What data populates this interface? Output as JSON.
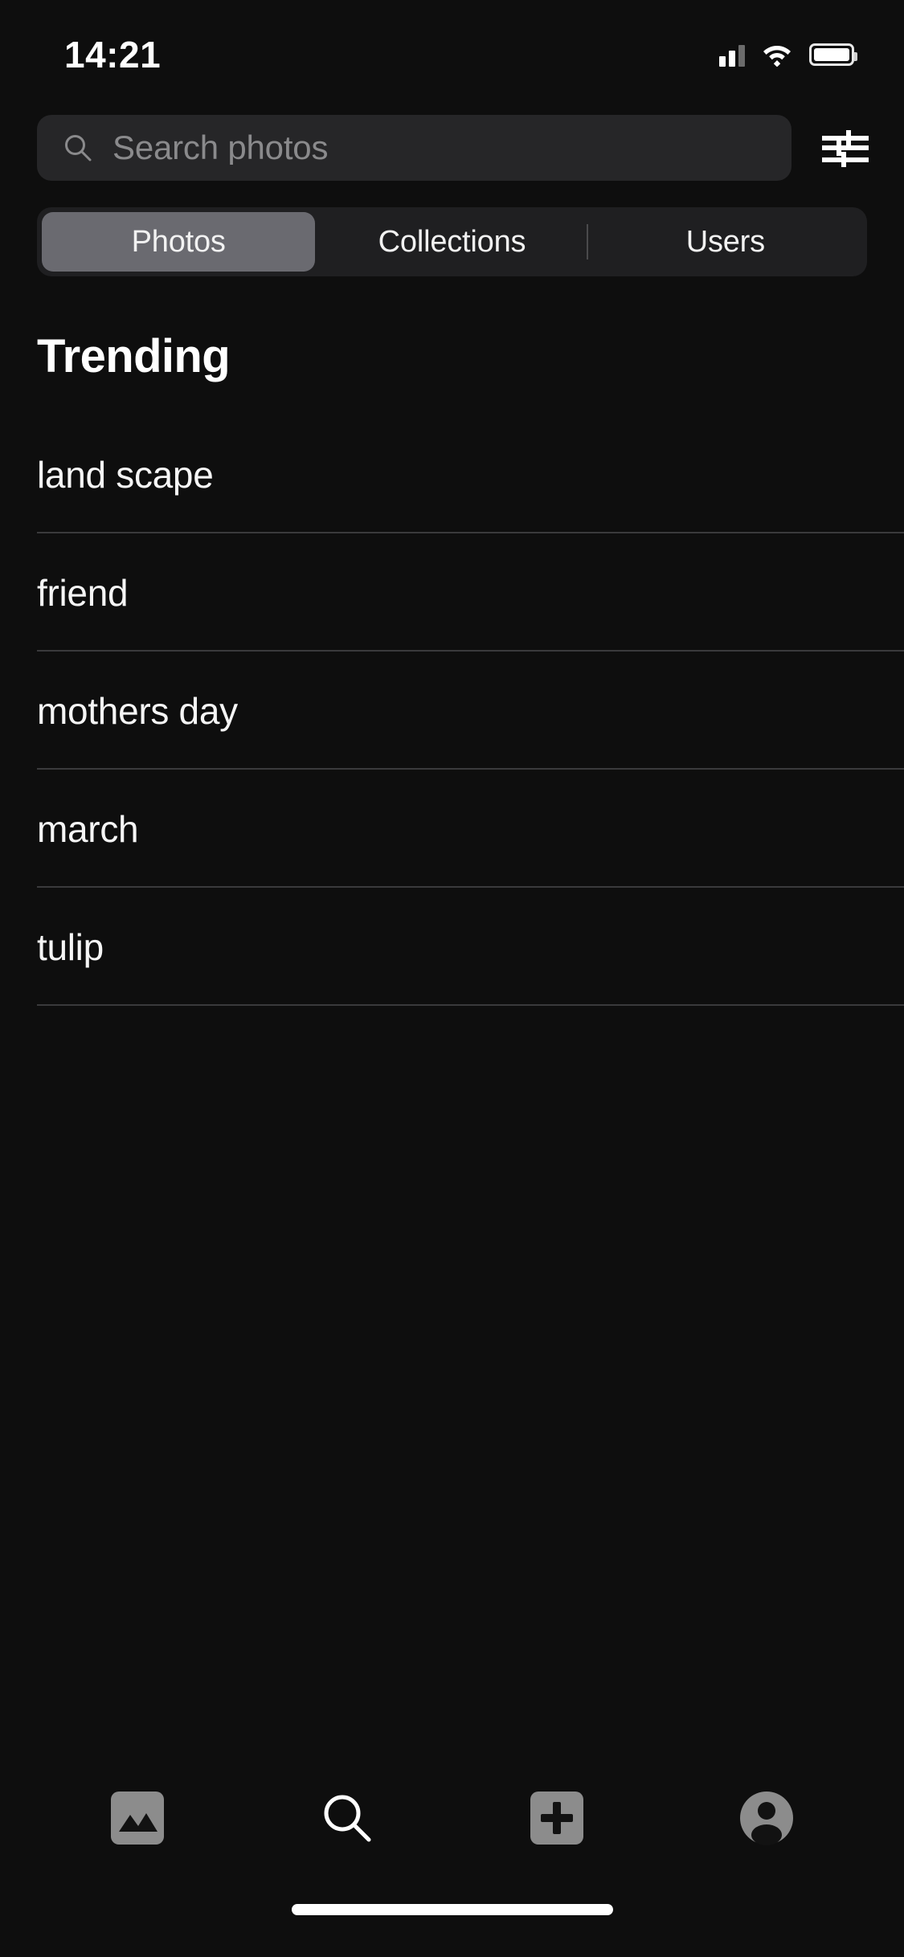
{
  "status_bar": {
    "time": "14:21",
    "cellular_icon": "cellular-signal-icon",
    "wifi_icon": "wifi-icon",
    "battery_icon": "battery-icon"
  },
  "search": {
    "placeholder": "Search photos",
    "value": "",
    "search_icon": "search-icon",
    "filter_icon": "filter-sliders-icon"
  },
  "tabs": {
    "items": [
      {
        "label": "Photos",
        "active": true
      },
      {
        "label": "Collections",
        "active": false
      },
      {
        "label": "Users",
        "active": false
      }
    ]
  },
  "main": {
    "section_title": "Trending",
    "trending": [
      {
        "label": "land scape"
      },
      {
        "label": "friend"
      },
      {
        "label": "mothers day"
      },
      {
        "label": "march"
      },
      {
        "label": "tulip"
      }
    ]
  },
  "bottom_nav": {
    "items": [
      {
        "name": "photos",
        "icon": "image-icon",
        "active": false
      },
      {
        "name": "search",
        "icon": "search-icon",
        "active": true
      },
      {
        "name": "add",
        "icon": "plus-icon",
        "active": false
      },
      {
        "name": "account",
        "icon": "person-circle-icon",
        "active": false
      }
    ]
  },
  "colors": {
    "background": "#0e0e0e",
    "search_field": "#262628",
    "segment_track": "#1f1f21",
    "segment_active": "#6a6a70",
    "divider": "#3a3a3c",
    "text_primary": "#ffffff",
    "text_placeholder": "#8a8a8c",
    "icon_inactive": "#8c8c8c"
  }
}
